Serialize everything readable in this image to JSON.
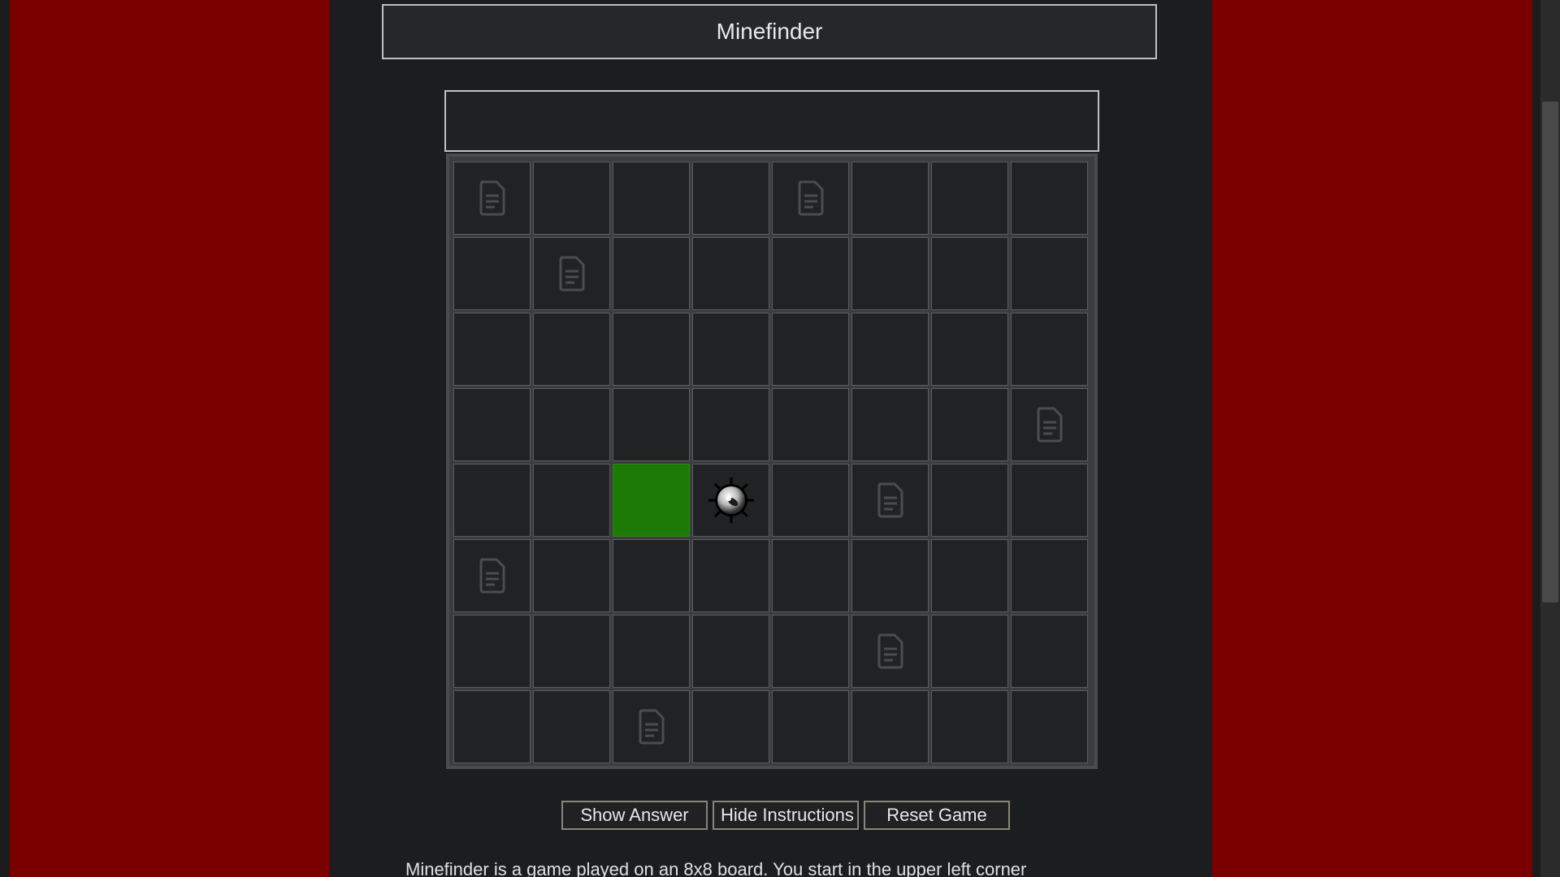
{
  "title": "Minefinder",
  "status_message": "",
  "board": {
    "rows": 8,
    "cols": 8,
    "cells": [
      [
        "doc",
        "",
        "",
        "",
        "doc",
        "",
        "",
        ""
      ],
      [
        "",
        "doc",
        "",
        "",
        "",
        "",
        "",
        ""
      ],
      [
        "",
        "",
        "",
        "",
        "",
        "",
        "",
        ""
      ],
      [
        "",
        "",
        "",
        "",
        "",
        "",
        "",
        "doc"
      ],
      [
        "",
        "",
        "green",
        "mine",
        "",
        "doc",
        "",
        ""
      ],
      [
        "doc",
        "",
        "",
        "",
        "",
        "",
        "",
        ""
      ],
      [
        "",
        "",
        "",
        "",
        "",
        "doc",
        "",
        ""
      ],
      [
        "",
        "",
        "doc",
        "",
        "",
        "",
        "",
        ""
      ]
    ]
  },
  "buttons": {
    "show_answer": "Show Answer",
    "hide_instructions": "Hide Instructions",
    "reset_game": "Reset Game"
  },
  "instructions_text": "Minefinder is a game played on an 8x8 board. You start in the upper left corner",
  "colors": {
    "side_panels": "#7a0000",
    "player_cell": "#1d7a07",
    "background": "#1c1d1f"
  },
  "icons": {
    "doc": "document-icon",
    "mine": "mine-icon"
  }
}
